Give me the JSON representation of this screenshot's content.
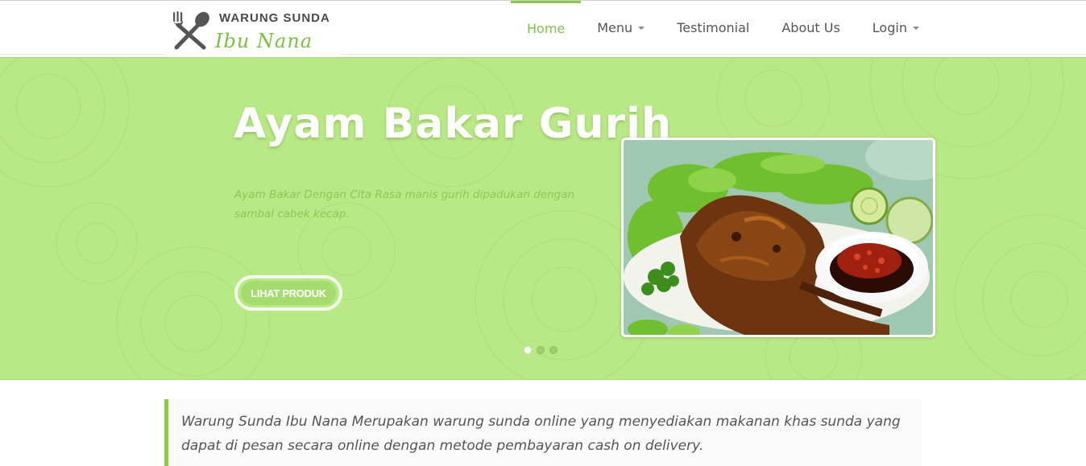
{
  "brand": {
    "name_top": "WARUNG SUNDA",
    "name_script": "Ibu Nana",
    "icon": "fork-spoon-icon"
  },
  "nav": {
    "items": [
      {
        "label": "Home",
        "active": true,
        "dropdown": false
      },
      {
        "label": "Menu",
        "active": false,
        "dropdown": true
      },
      {
        "label": "Testimonial",
        "active": false,
        "dropdown": false
      },
      {
        "label": "About Us",
        "active": false,
        "dropdown": false
      },
      {
        "label": "Login",
        "active": false,
        "dropdown": true
      }
    ]
  },
  "hero": {
    "title": "Ayam Bakar Gurih",
    "description": "Ayam Bakar Dengan Cita Rasa manis gurih dipadukan dengan sambal cabek kecap.",
    "button_label": "LIHAT PRODUK",
    "image": "grilled-chicken-with-sambal-photo",
    "slides_count": 3,
    "active_slide": 1
  },
  "intro": {
    "text": "Warung Sunda Ibu Nana Merupakan warung sunda online yang menyediakan makanan khas sunda yang dapat di pesan secara online dengan metode pembayaran cash on delivery."
  },
  "colors": {
    "accent": "#8cc54f",
    "hero_bg": "#b9e886",
    "nav_text": "#555555"
  }
}
